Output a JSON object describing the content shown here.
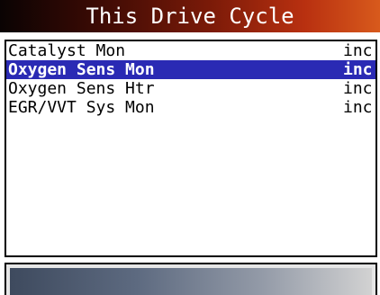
{
  "header": {
    "title": "This Drive Cycle"
  },
  "monitors": [
    {
      "label": "Catalyst Mon",
      "status": "inc"
    },
    {
      "label": "Oxygen Sens Mon",
      "status": "inc"
    },
    {
      "label": "Oxygen Sens Htr",
      "status": "inc"
    },
    {
      "label": "EGR/VVT Sys Mon",
      "status": "inc"
    }
  ],
  "selected_index": 1,
  "colors": {
    "selection": "#2a2ab4",
    "title_gradient_end": "#d85a1c",
    "bottom_bar_start": "#3e4a5e"
  }
}
